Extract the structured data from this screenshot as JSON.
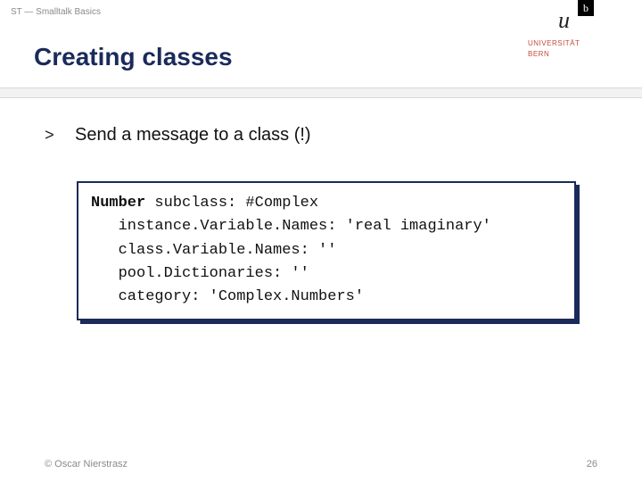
{
  "header": {
    "breadcrumb": "ST — Smalltalk Basics",
    "title": "Creating classes",
    "logo": {
      "letter_u": "u",
      "letter_b": "b",
      "uni_line1": "UNIVERSITÄT",
      "uni_line2": "BERN"
    }
  },
  "content": {
    "bullet_marker": ">",
    "bullet_text": "Send a message to a class (!)",
    "code": {
      "bold_word": "Number",
      "line1_rest": " subclass: #Complex",
      "line2": "   instance.Variable.Names: 'real imaginary'",
      "line3": "   class.Variable.Names: ''",
      "line4": "   pool.Dictionaries: ''",
      "line5": "   category: 'Complex.Numbers'"
    }
  },
  "footer": {
    "copyright": "© Oscar Nierstrasz",
    "page_number": "26"
  }
}
